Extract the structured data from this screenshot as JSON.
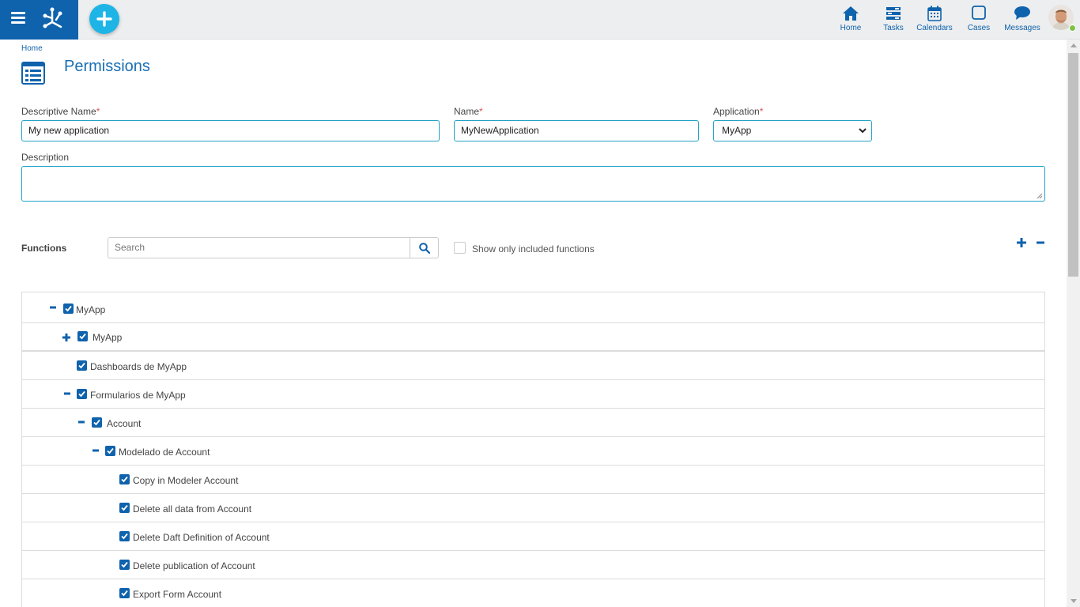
{
  "topbar": {
    "nav": [
      {
        "id": "home",
        "label": "Home",
        "icon": "home-icon"
      },
      {
        "id": "tasks",
        "label": "Tasks",
        "icon": "tasks-icon"
      },
      {
        "id": "calendars",
        "label": "Calendars",
        "icon": "calendar-icon"
      },
      {
        "id": "cases",
        "label": "Cases",
        "icon": "cases-icon"
      },
      {
        "id": "messages",
        "label": "Messages",
        "icon": "message-icon"
      }
    ]
  },
  "header": {
    "breadcrumb": "Home",
    "title": "Permissions"
  },
  "form": {
    "descriptive_name": {
      "label": "Descriptive Name",
      "required_mark": "*",
      "value": "My new application"
    },
    "name": {
      "label": "Name",
      "required_mark": "*",
      "value": "MyNewApplication"
    },
    "application": {
      "label": "Application",
      "required_mark": "*",
      "value": "MyApp"
    },
    "description": {
      "label": "Description",
      "value": ""
    }
  },
  "functions": {
    "label": "Functions",
    "search_placeholder": "Search",
    "show_only_label": "Show only included functions",
    "show_only_checked": false
  },
  "tree": {
    "rows": [
      {
        "label": "MyApp",
        "toggle": "collapse",
        "checked": true
      },
      {
        "label": "MyApp",
        "toggle": "expand",
        "checked": true
      },
      {
        "label": "Dashboards de MyApp",
        "toggle": "none",
        "checked": true
      },
      {
        "label": "Formularios de MyApp",
        "toggle": "collapse",
        "checked": true
      },
      {
        "label": "Account",
        "toggle": "collapse",
        "checked": true
      },
      {
        "label": "Modelado de Account",
        "toggle": "collapse",
        "checked": true
      },
      {
        "label": "Copy in Modeler Account",
        "toggle": "none",
        "checked": true
      },
      {
        "label": "Delete all data from Account",
        "toggle": "none",
        "checked": true
      },
      {
        "label": "Delete Daft Definition of Account",
        "toggle": "none",
        "checked": true
      },
      {
        "label": "Delete publication of Account",
        "toggle": "none",
        "checked": true
      },
      {
        "label": "Export Form Account",
        "toggle": "none",
        "checked": true
      }
    ]
  },
  "colors": {
    "primary": "#0f62ac",
    "accent": "#1fb4e6",
    "input_border": "#23a3c7",
    "required": "#d9534f"
  }
}
